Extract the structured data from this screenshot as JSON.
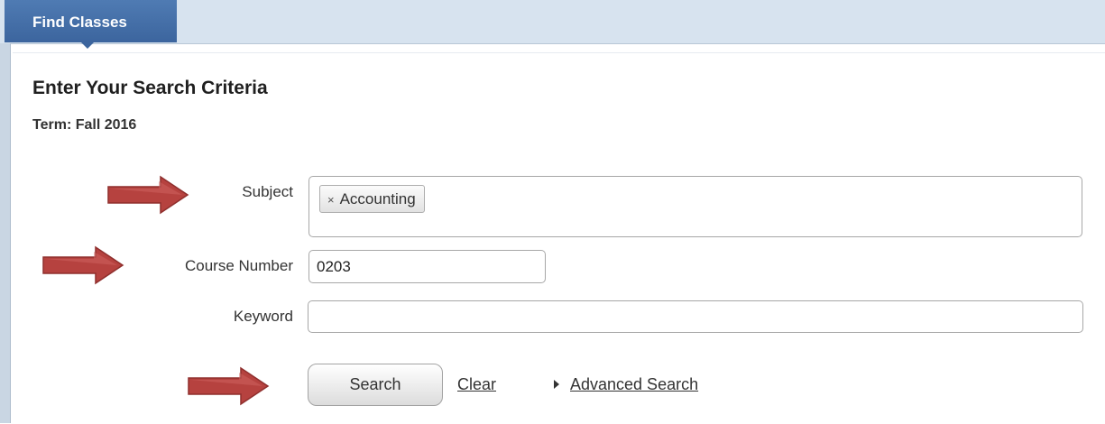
{
  "tabs": [
    {
      "label": "Find Classes"
    }
  ],
  "panel": {
    "title": "Enter Your Search Criteria",
    "term_label": "Term:",
    "term_value": "Fall 2016"
  },
  "form": {
    "subject": {
      "label": "Subject",
      "selected": [
        {
          "label": "Accounting",
          "remove_glyph": "×"
        }
      ]
    },
    "course_number": {
      "label": "Course Number",
      "value": "0203"
    },
    "keyword": {
      "label": "Keyword",
      "value": ""
    }
  },
  "actions": {
    "search_label": "Search",
    "clear_label": "Clear",
    "advanced_label": "Advanced Search"
  },
  "colors": {
    "tab": "#3c659e",
    "tab_strip": "#d7e3ef",
    "arrow": "#b6423f"
  },
  "icons": [
    "close-icon",
    "caret-right-icon",
    "arrow-right-icon"
  ]
}
